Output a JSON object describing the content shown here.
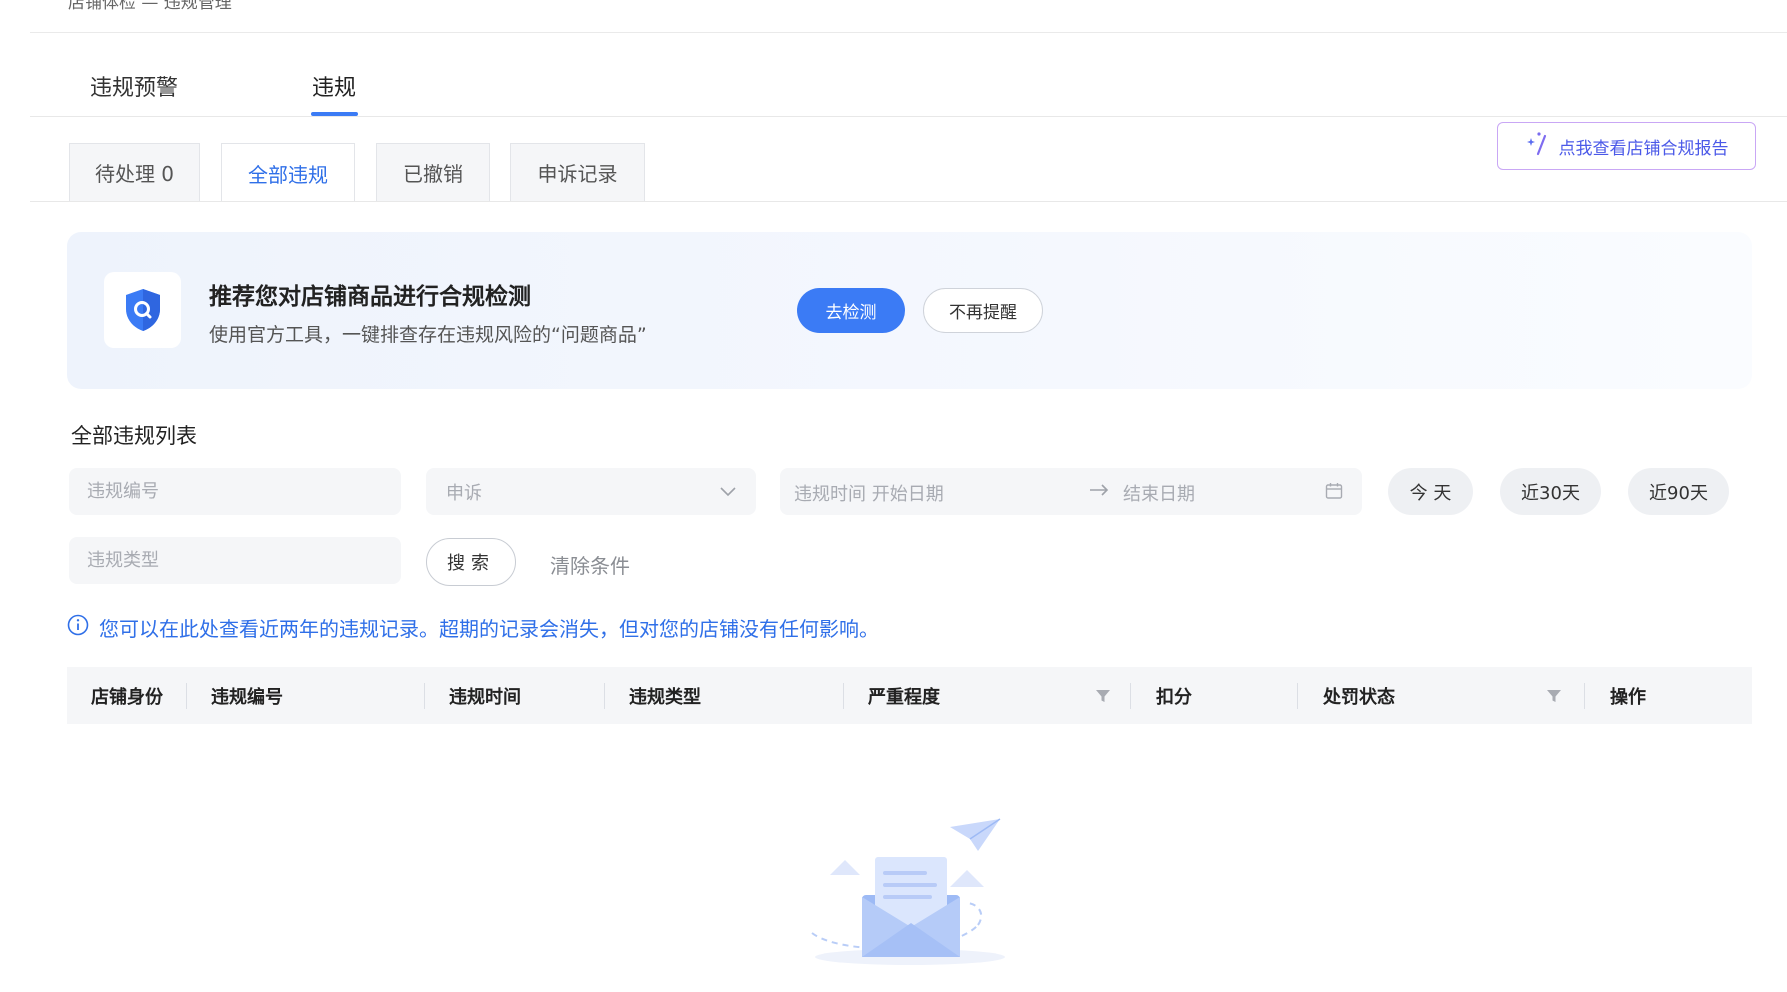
{
  "breadcrumb": {
    "text": "店铺体检 — 违规管理"
  },
  "main_tabs": [
    {
      "label": "违规预警",
      "active": false
    },
    {
      "label": "违规",
      "active": true
    }
  ],
  "sub_tabs": [
    {
      "label": "待处理 0",
      "active": false
    },
    {
      "label": "全部违规",
      "active": true
    },
    {
      "label": "已撤销",
      "active": false
    },
    {
      "label": "申诉记录",
      "active": false
    }
  ],
  "report_button": {
    "label": "点我查看店铺合规报告",
    "icon": "sparkle-wand-icon"
  },
  "banner": {
    "title": "推荐您对店铺商品进行合规检测",
    "subtitle": "使用官方工具，一键排查存在违规风险的“问题商品”",
    "check_button": "去检测",
    "dismiss_button": "不再提醒",
    "icon": "shield-search-icon"
  },
  "list_title": "全部违规列表",
  "filters": {
    "violation_no_placeholder": "违规编号",
    "appeal_select": {
      "value": "申诉"
    },
    "start_date_placeholder": "违规时间 开始日期",
    "end_date_placeholder": "结束日期",
    "quick_ranges": [
      "今 天",
      "近30天",
      "近90天"
    ],
    "violation_type_placeholder": "违规类型",
    "search_button": "搜索",
    "clear_button": "清除条件"
  },
  "info_text": "您可以在此处查看近两年的违规记录。超期的记录会消失，但对您的店铺没有任何影响。",
  "table": {
    "columns": [
      "店铺身份",
      "违规编号",
      "违规时间",
      "违规类型",
      "严重程度",
      "扣分",
      "处罚状态",
      "操作"
    ],
    "filterable_columns": [
      "严重程度",
      "处罚状态"
    ],
    "rows": []
  },
  "colors": {
    "accent": "#3b7bf5",
    "link": "#2f6fe8",
    "report_border": "#c9a7f5"
  }
}
